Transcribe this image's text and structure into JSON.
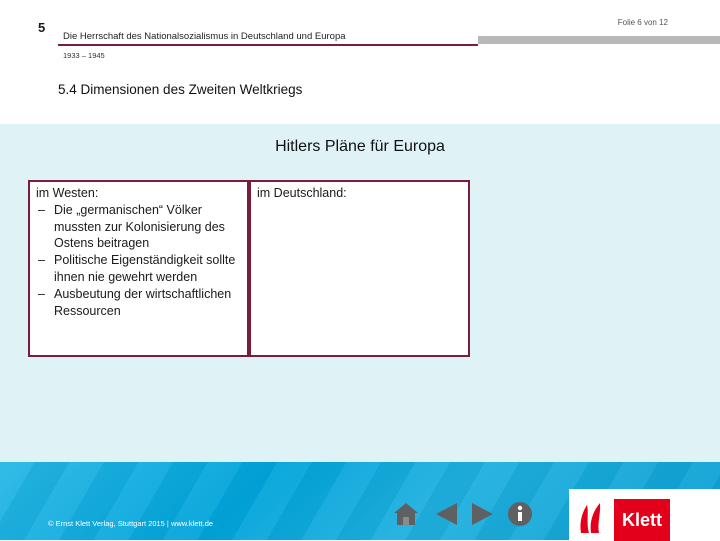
{
  "header": {
    "chapter_number": "5",
    "title": "Die Herrschaft des Nationalsozialismus in Deutschland und Europa",
    "dates": "1933 – 1945",
    "slide_counter": "Folie 6 von 12"
  },
  "section_title": "5.4 Dimensionen des Zweiten Weltkriegs",
  "main_heading": "Hitlers Pläne für Europa",
  "west_box": {
    "heading": "im Westen:",
    "items": [
      "Die „germanischen“ Völker mussten zur Kolonisierung des Ostens beitragen",
      "Politische Eigenständigkeit sollte ihnen nie gewehrt werden",
      "Ausbeutung der wirtschaftlichen Ressourcen"
    ]
  },
  "germany_box": {
    "heading": "im Deutschland:"
  },
  "footer": {
    "copyright": "© Ernst Klett Verlag, Stuttgart 2015 | www.klett.de",
    "logo_text": "Klett",
    "nav_icons": [
      "home-icon",
      "previous-icon",
      "next-icon",
      "info-icon"
    ]
  },
  "colors": {
    "accent": "#7b1c3e",
    "content_background": "#dff3f7",
    "footer_blue": "#00a4da",
    "logo_red": "#e3001b"
  }
}
